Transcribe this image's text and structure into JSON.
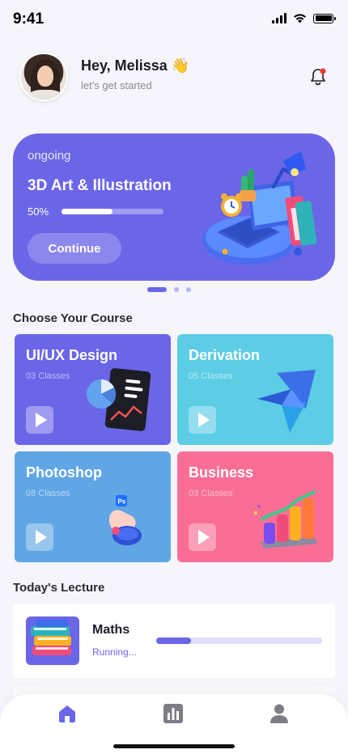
{
  "status_bar": {
    "time": "9:41"
  },
  "header": {
    "greeting": "Hey, Melissa",
    "greeting_emoji": "👋",
    "subtitle": "let's get started"
  },
  "hero": {
    "tag": "ongoing",
    "title": "3D Art & Illustration",
    "progress_label": "50%",
    "progress": 0.5,
    "button_label": "Continue"
  },
  "carousel": {
    "count": 3,
    "active_index": 0
  },
  "courses_section": {
    "title": "Choose Your Course",
    "items": [
      {
        "name": "UI/UX Design",
        "classes": "03 Classes",
        "color": "#6b66e8"
      },
      {
        "name": "Derivation",
        "classes": "05 Classes",
        "color": "#5dcde6"
      },
      {
        "name": "Photoshop",
        "classes": "08 Classes",
        "color": "#60a6e5"
      },
      {
        "name": "Business",
        "classes": "03 Classes",
        "color": "#fa6e96"
      }
    ]
  },
  "lecture_section": {
    "title": "Today's Lecture",
    "items": [
      {
        "name": "Maths",
        "status": "Running...",
        "progress": 0.21
      }
    ]
  },
  "bottom_nav": {
    "items": [
      {
        "icon": "home-icon",
        "active": true
      },
      {
        "icon": "chart-icon",
        "active": false
      },
      {
        "icon": "profile-icon",
        "active": false
      }
    ],
    "active_color": "#6b66e8",
    "inactive_color": "#7d7d86"
  }
}
